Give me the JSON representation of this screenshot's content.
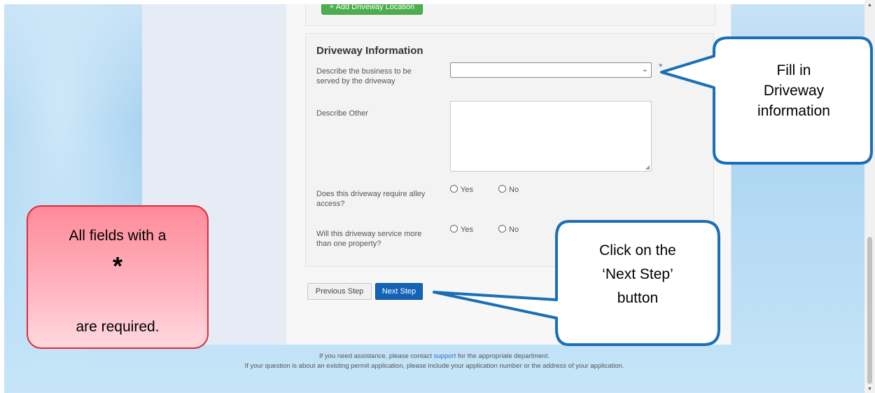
{
  "top_section": {
    "add_button_label": "+ Add Driveway Location"
  },
  "driveway_info": {
    "title": "Driveway Information",
    "business_label": "Describe the business to be served by the driveway",
    "business_select_value": "",
    "required_marker": "*",
    "other_label": "Describe Other",
    "other_value": "",
    "alley_label": "Does this driveway require alley access?",
    "multi_label": "Will this driveway service more than one property?",
    "yes_label": "Yes",
    "no_label": "No"
  },
  "buttons": {
    "previous": "Previous Step",
    "next": "Next Step"
  },
  "footer": {
    "line1_pre": "If you need assistance, please contact",
    "line1_link": "support",
    "line1_post": "for the appropriate department.",
    "line2": "If your question is about an existing permit application, please include your application number or the address of your application."
  },
  "callouts": {
    "fill_in": [
      "Fill in",
      "Driveway",
      "information"
    ],
    "next_step": [
      "Click on the",
      "‘Next Step’",
      "button"
    ],
    "required_top": "All fields with a",
    "required_star": "*",
    "required_bottom": "are required."
  },
  "colors": {
    "callout_blue": "#1a6fb6",
    "callout_red": "#e3283a",
    "primary_button": "#1463b8",
    "add_button": "#4cae4c"
  }
}
